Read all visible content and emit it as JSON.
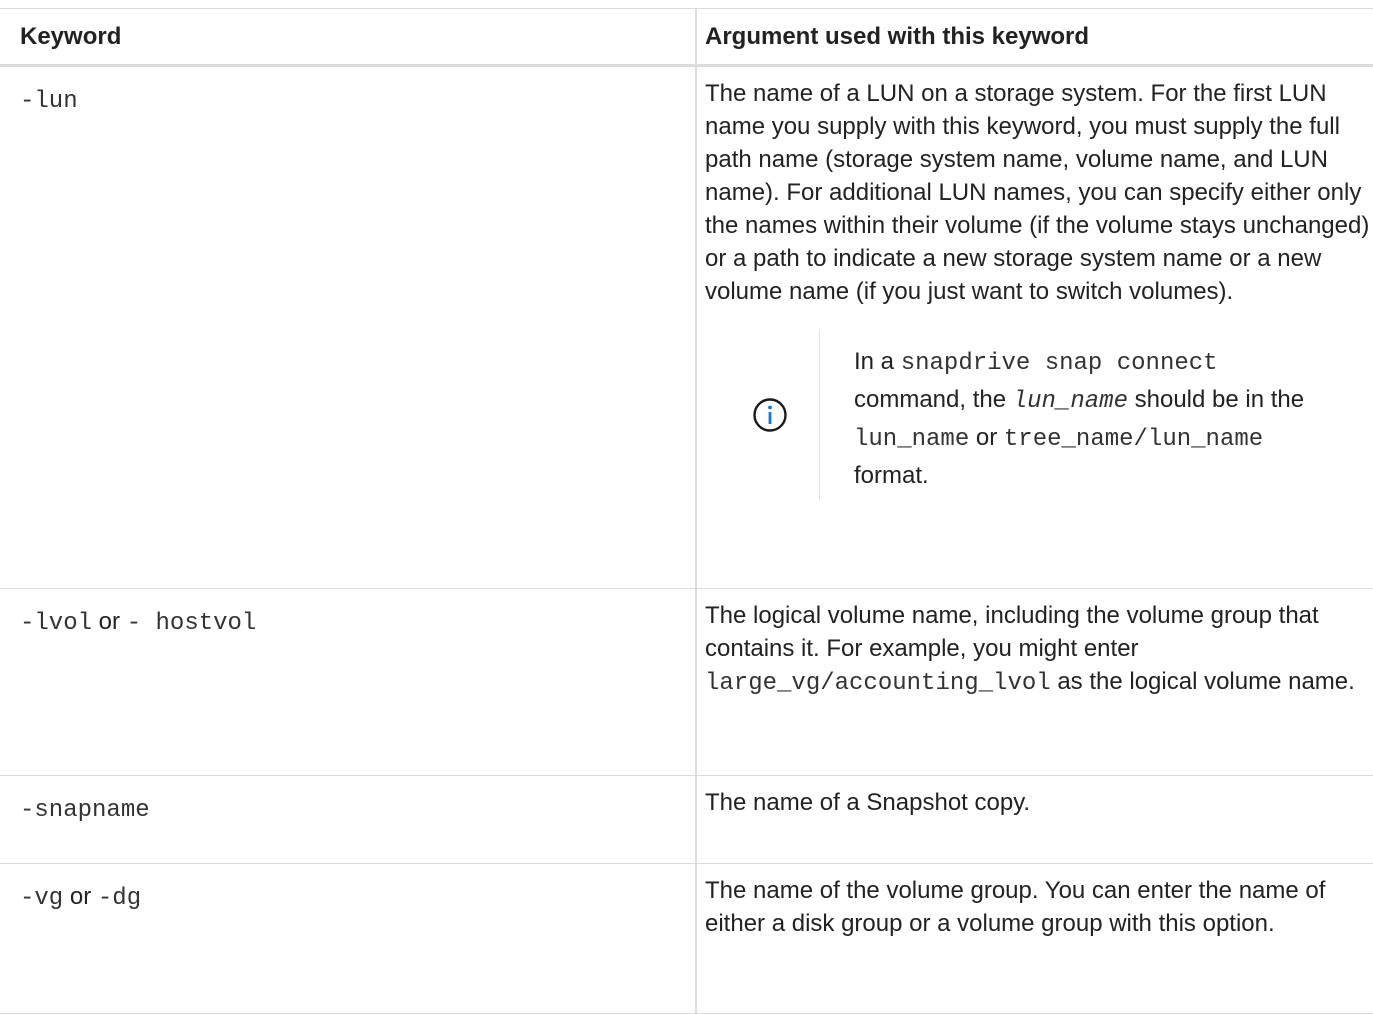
{
  "table": {
    "headers": {
      "keyword": "Keyword",
      "argument": "Argument used with this keyword"
    },
    "rows": [
      {
        "keyword": "-lun",
        "description": "The name of a LUN on a storage system. For the first LUN name you supply with this keyword, you must supply the full path name (storage system name, volume name, and LUN name). For additional LUN names, you can specify either only the names within their volume (if the volume stays unchanged) or a path to indicate a new storage system name or a new volume name (if you just want to switch volumes).",
        "note": {
          "icon": "info-icon",
          "text_1": "In a ",
          "code_1": "snapdrive snap connect",
          "text_2": " command, the ",
          "code_2": "lun_name",
          "text_3": " should be in the ",
          "code_3": "lun_name",
          "text_4": " or ",
          "code_4": "tree_name/lun_name",
          "text_5": " format."
        }
      },
      {
        "keyword_1": "-lvol",
        "keyword_sep": " or ",
        "keyword_2": "- hostvol",
        "description_1": "The logical volume name, including the volume group that contains it. For example, you might enter ",
        "description_code": "large_vg/accounting_lvol",
        "description_2": " as the logical volume name."
      },
      {
        "keyword": "-snapname",
        "description": "The name of a Snapshot copy."
      },
      {
        "keyword_1": "-vg",
        "keyword_sep": " or ",
        "keyword_2": "-dg",
        "description": "The name of the volume group. You can enter the name of either a disk group or a volume group with this option."
      }
    ]
  }
}
